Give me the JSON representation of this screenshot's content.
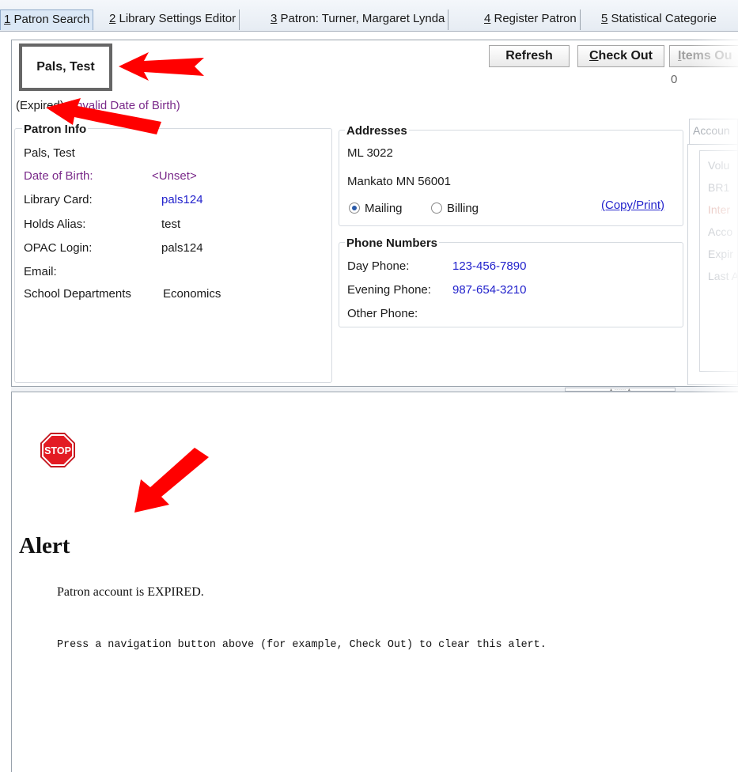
{
  "tabs": [
    {
      "num": "1",
      "label": " Patron Search",
      "active": true
    },
    {
      "num": "2",
      "label": " Library Settings Editor"
    },
    {
      "num": "3",
      "label": " Patron: Turner, Margaret Lynda"
    },
    {
      "num": "4",
      "label": " Register Patron"
    },
    {
      "num": "5",
      "label": " Statistical Categorie"
    }
  ],
  "patron": {
    "display_name": "Pals, Test",
    "status_expired": "(Expired)",
    "status_invalid_dob": "(Invalid Date of Birth)"
  },
  "toolbar": {
    "refresh_label": "Refresh",
    "checkout_accel": "C",
    "checkout_rest": "heck Out",
    "items_out_accel": "I",
    "items_out_rest": "tems Ou",
    "items_out_count": "0"
  },
  "patron_info": {
    "title": "Patron Info",
    "name": "Pals, Test",
    "fields": [
      {
        "label": "Date of Birth:",
        "value": "<Unset>"
      },
      {
        "label": "Library Card:",
        "value": "pals124"
      },
      {
        "label": "Holds Alias:",
        "value": "test"
      },
      {
        "label": "OPAC Login:",
        "value": "pals124"
      },
      {
        "label": "Email:",
        "value": ""
      },
      {
        "label": "School Departments",
        "value": "Economics"
      }
    ]
  },
  "addresses": {
    "title": "Addresses",
    "line1": "ML 3022",
    "line2": "Mankato  MN  56001",
    "mailing_label": "Mailing",
    "billing_label": "Billing",
    "selected": "Mailing",
    "copy_print_label": "(Copy/Print)"
  },
  "phones": {
    "title": "Phone Numbers",
    "rows": [
      {
        "label": "Day Phone:",
        "value": "123-456-7890"
      },
      {
        "label": "Evening Phone:",
        "value": "987-654-3210"
      },
      {
        "label": "Other Phone:",
        "value": ""
      }
    ]
  },
  "account": {
    "tab_label": "Accoun",
    "items": [
      "Volu",
      "BR1",
      "Inter",
      "Acco",
      "Expir",
      "Last A"
    ]
  },
  "alert": {
    "title": "Alert",
    "message": "Patron account is EXPIRED.",
    "hint": "Press a navigation button above (for example, Check Out) to clear this alert."
  },
  "icons": {
    "stop": "stop-sign-icon",
    "annotation": "red-arrow-icon"
  },
  "colors": {
    "accent_link": "#2222cc",
    "warning_purple": "#7a2a8a",
    "stop_red": "#e31b23",
    "annotation_red": "#ff0000"
  }
}
